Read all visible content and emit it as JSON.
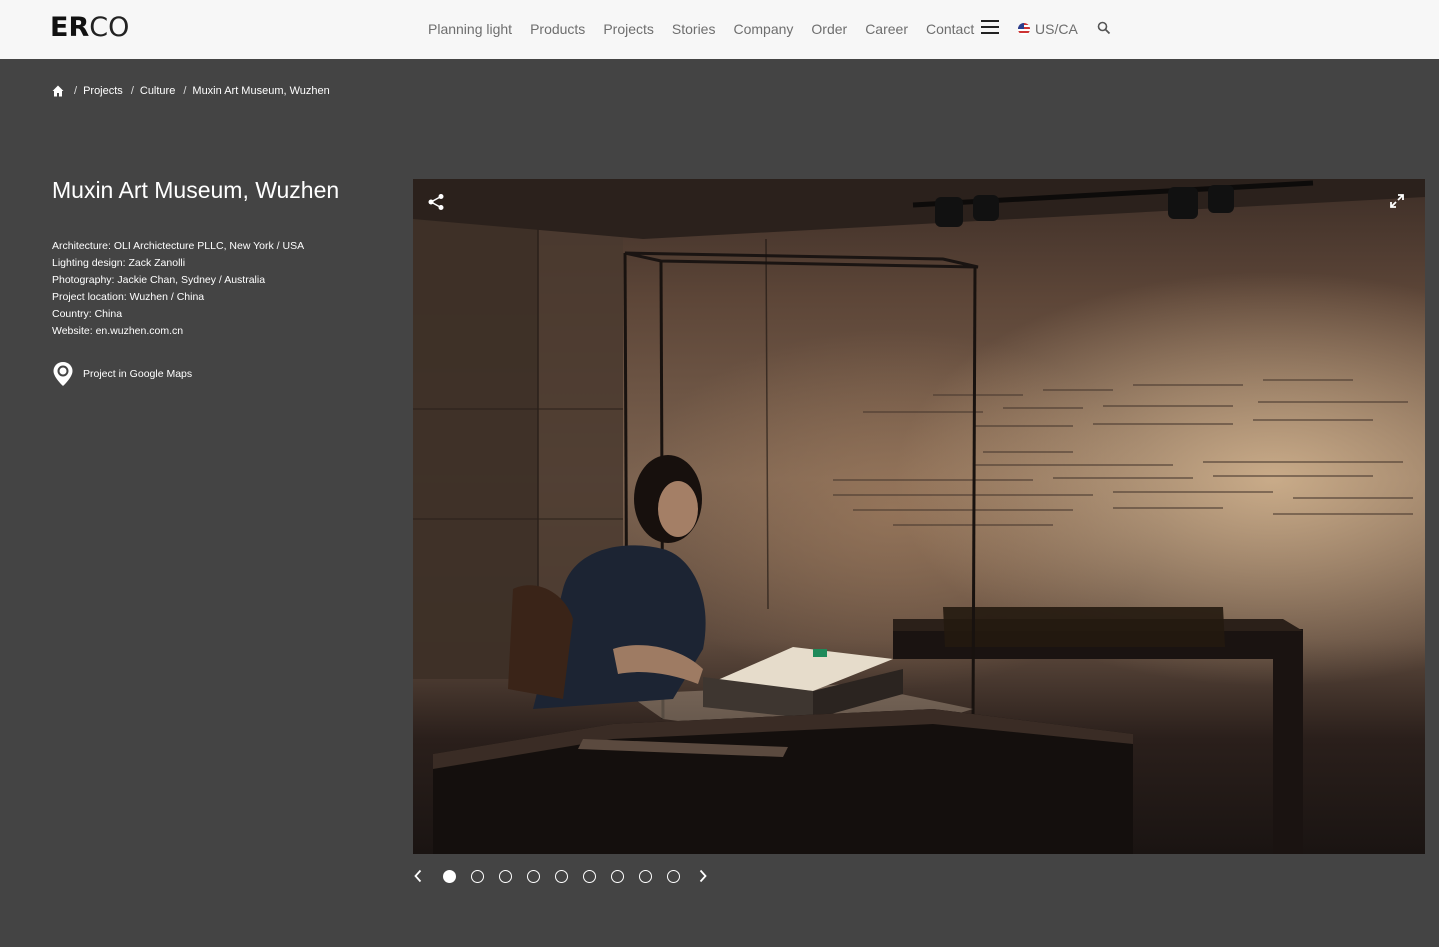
{
  "header": {
    "logo_bold": "ER",
    "logo_light": "CO",
    "nav": [
      "Planning light",
      "Products",
      "Projects",
      "Stories",
      "Company",
      "Order",
      "Career",
      "Contact"
    ],
    "locale": "US/CA"
  },
  "breadcrumb": {
    "items": [
      "Projects",
      "Culture"
    ],
    "current": "Muxin Art Museum, Wuzhen",
    "separator": "/"
  },
  "project": {
    "title": "Muxin Art Museum, Wuzhen",
    "details": [
      "Architecture: OLI Archictecture PLLC, New York / USA",
      "Lighting design: Zack Zanolli",
      "Photography: Jackie Chan, Sydney / Australia",
      "Project location: Wuzhen / China",
      "Country: China",
      "Website: en.wuzhen.com.cn"
    ],
    "maps_label": "Project in Google Maps"
  },
  "gallery": {
    "slide_count": 9,
    "active_slide": 1
  },
  "colors": {
    "header_bg": "#f7f7f7",
    "page_bg": "#444444",
    "nav_text": "#6e6e6e"
  }
}
